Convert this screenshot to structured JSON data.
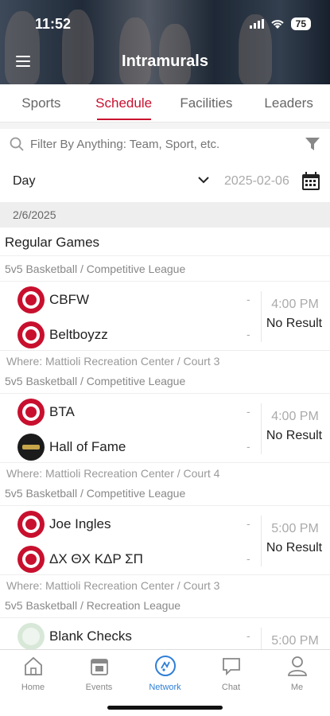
{
  "status": {
    "time": "11:52",
    "battery": "75"
  },
  "header": {
    "title": "Intramurals"
  },
  "tabs": [
    {
      "label": "Sports"
    },
    {
      "label": "Schedule"
    },
    {
      "label": "Facilities"
    },
    {
      "label": "Leaders"
    }
  ],
  "filter": {
    "placeholder": "Filter By Anything: Team, Sport, etc."
  },
  "date_row": {
    "mode": "Day",
    "date": "2025-02-06"
  },
  "section": {
    "date": "2/6/2025",
    "title": "Regular Games"
  },
  "games": [
    {
      "league": "5v5 Basketball / Competitive League",
      "team1": "CBFW",
      "team2": "Beltboyzz",
      "score1": "-",
      "score2": "-",
      "time": "4:00 PM",
      "result": "No Result",
      "where": "Where: Mattioli Recreation Center / Court 3"
    },
    {
      "league": "5v5 Basketball / Competitive League",
      "team1": "BTA",
      "team2": "Hall of Fame",
      "score1": "-",
      "score2": "-",
      "time": "4:00 PM",
      "result": "No Result",
      "where": "Where: Mattioli Recreation Center / Court 4"
    },
    {
      "league": "5v5 Basketball / Competitive League",
      "team1": "Joe Ingles",
      "team2": "ΔΧ ΘΧ ΚΔΡ ΣΠ",
      "score1": "-",
      "score2": "-",
      "time": "5:00 PM",
      "result": "No Result",
      "where": "Where: Mattioli Recreation Center / Court 3"
    },
    {
      "league": "5v5 Basketball / Recreation League",
      "team1": "Blank Checks",
      "team2": "",
      "score1": "-",
      "score2": "",
      "time": "5:00 PM",
      "result": "",
      "where": ""
    }
  ],
  "bottom_nav": [
    {
      "label": "Home",
      "icon": "home-icon"
    },
    {
      "label": "Events",
      "icon": "calendar-icon"
    },
    {
      "label": "Network",
      "icon": "network-icon"
    },
    {
      "label": "Chat",
      "icon": "chat-icon"
    },
    {
      "label": "Me",
      "icon": "person-icon"
    }
  ],
  "colors": {
    "accent": "#c8102e",
    "nav_active": "#2f7fd6"
  }
}
